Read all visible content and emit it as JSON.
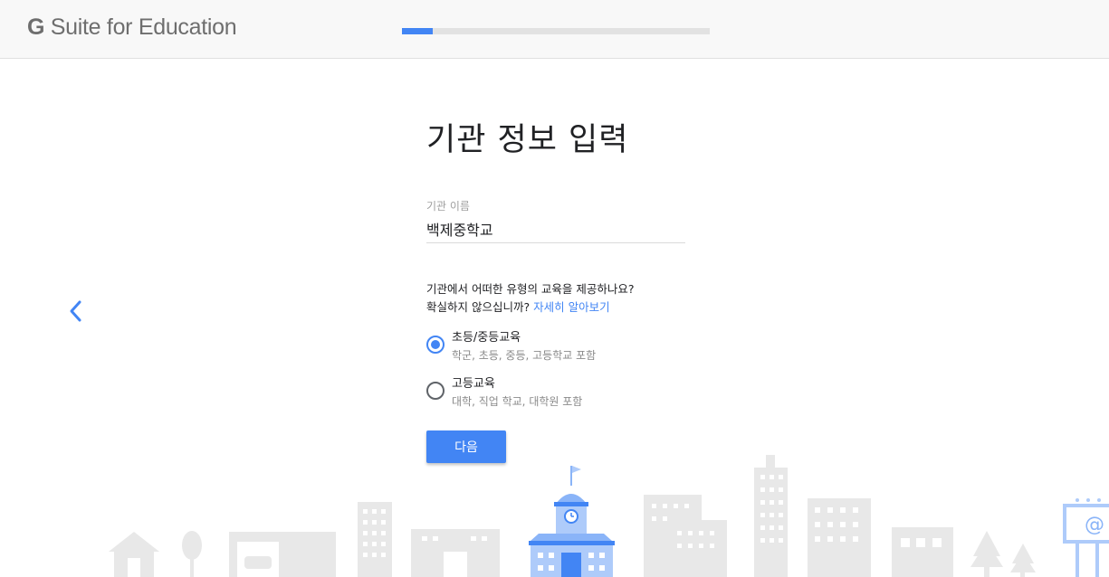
{
  "header": {
    "brand_g": "G",
    "brand_rest": " Suite for Education",
    "progress_fraction": 0.1
  },
  "nav": {
    "back_icon": "chevron-left-icon"
  },
  "form": {
    "title": "기관 정보 입력",
    "institution_name_label": "기관 이름",
    "institution_name_value": "백제중학교",
    "question_line1": "기관에서 어떠한 유형의 교육을 제공하나요?",
    "question_line2": "확실하지 않으십니까?",
    "learn_more_link": "자세히 알아보기",
    "options": [
      {
        "title": "초등/중등교육",
        "description": "학군, 초등, 중등, 고등학교 포함",
        "selected": true
      },
      {
        "title": "고등교육",
        "description": "대학, 직업 학교, 대학원 포함",
        "selected": false
      }
    ],
    "next_button": "다음"
  },
  "illustration": {
    "billboard_symbol": "@"
  },
  "colors": {
    "accent": "#4285f4",
    "topbar_bg": "#f8f8f8",
    "skyline_gray": "#e8e8e8",
    "school_blue": "#8ab4f8"
  }
}
